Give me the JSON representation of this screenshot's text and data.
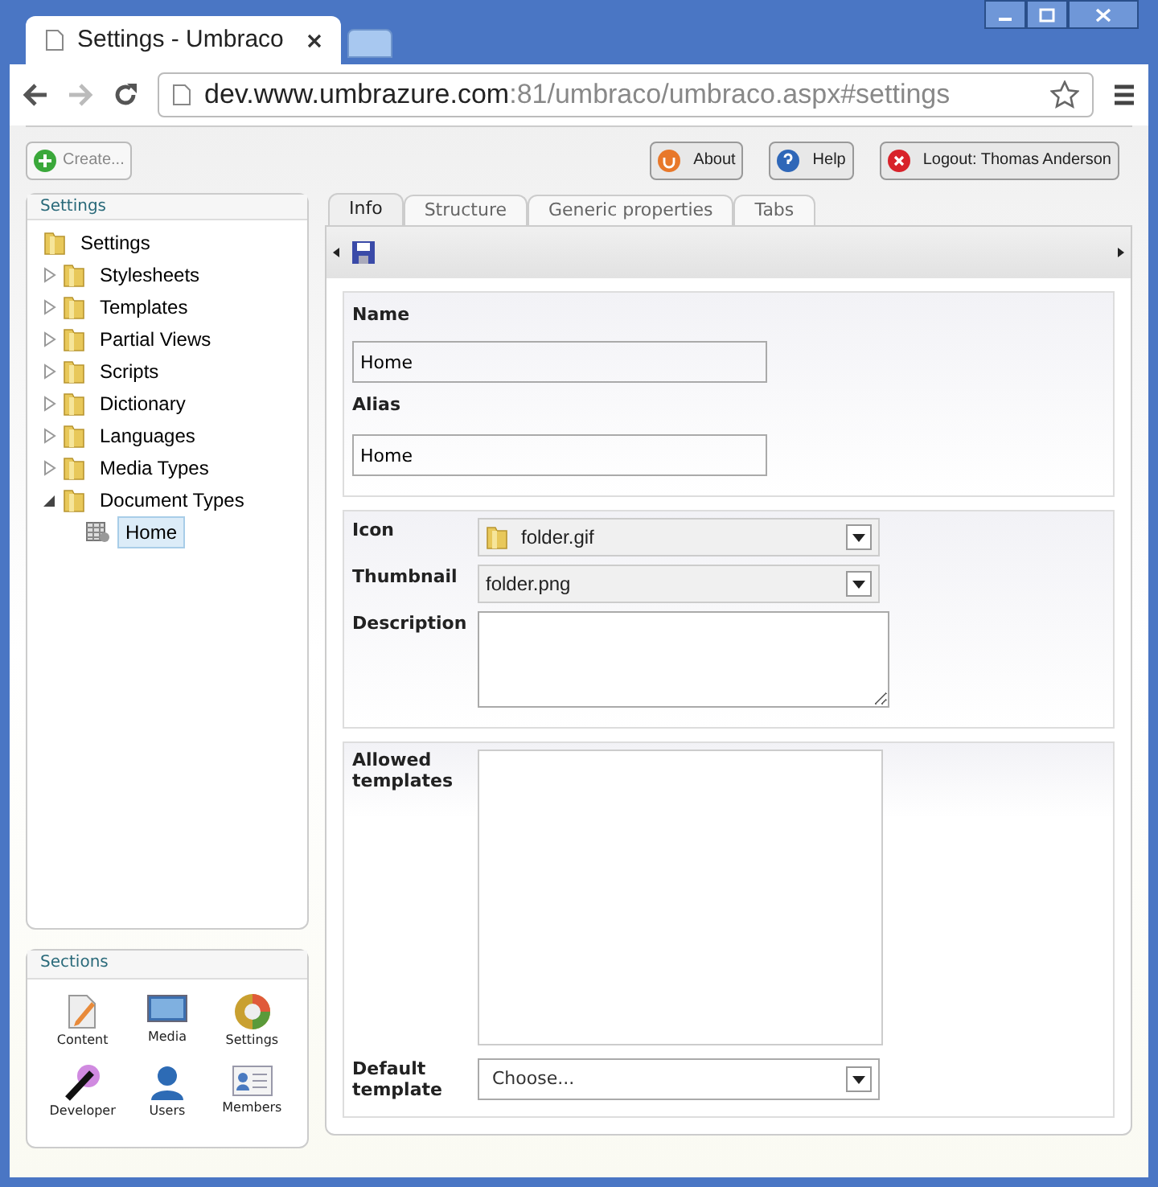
{
  "browser": {
    "tab_title": "Settings - Umbraco",
    "url_host": "dev.www.umbrazure.com",
    "url_path": ":81/umbraco/umbraco.aspx#settings"
  },
  "toolbar": {
    "create": "Create...",
    "buttons": [
      {
        "kind": "about",
        "label": "About"
      },
      {
        "kind": "help",
        "label": "Help"
      },
      {
        "kind": "logout",
        "label": "Logout: Thomas Anderson"
      }
    ]
  },
  "tree_panel": {
    "title": "Settings",
    "root": {
      "label": "Settings",
      "selected": false,
      "children": [
        {
          "label": "Stylesheets",
          "expanded": false,
          "selected": false
        },
        {
          "label": "Templates",
          "expanded": false,
          "selected": false
        },
        {
          "label": "Partial Views",
          "expanded": false,
          "selected": false
        },
        {
          "label": "Scripts",
          "expanded": false,
          "selected": false
        },
        {
          "label": "Dictionary",
          "expanded": false,
          "selected": false
        },
        {
          "label": "Languages",
          "expanded": false,
          "selected": false
        },
        {
          "label": "Media Types",
          "expanded": false,
          "selected": false
        },
        {
          "label": "Document Types",
          "expanded": true,
          "selected": false,
          "children": [
            {
              "label": "Home",
              "kind": "doctype",
              "selected": true
            }
          ]
        }
      ]
    }
  },
  "sections": {
    "title": "Sections",
    "items": [
      {
        "kind": "content",
        "label": "Content"
      },
      {
        "kind": "media",
        "label": "Media"
      },
      {
        "kind": "settings",
        "label": "Settings"
      },
      {
        "kind": "developer",
        "label": "Developer"
      },
      {
        "kind": "users",
        "label": "Users"
      },
      {
        "kind": "members",
        "label": "Members"
      }
    ]
  },
  "tabs": [
    {
      "label": "Info",
      "selected": true
    },
    {
      "label": "Structure",
      "selected": false
    },
    {
      "label": "Generic properties",
      "selected": false
    },
    {
      "label": "Tabs",
      "selected": false
    }
  ],
  "form": {
    "name_label": "Name",
    "name_value": "Home",
    "alias_label": "Alias",
    "alias_value": "Home",
    "icon_label": "Icon",
    "icon_value": "folder.gif",
    "thumbnail_label": "Thumbnail",
    "thumbnail_value": "folder.png",
    "description_label": "Description",
    "allowed_label": "Allowed templates",
    "default_label": "Default template",
    "default_value": "Choose..."
  }
}
